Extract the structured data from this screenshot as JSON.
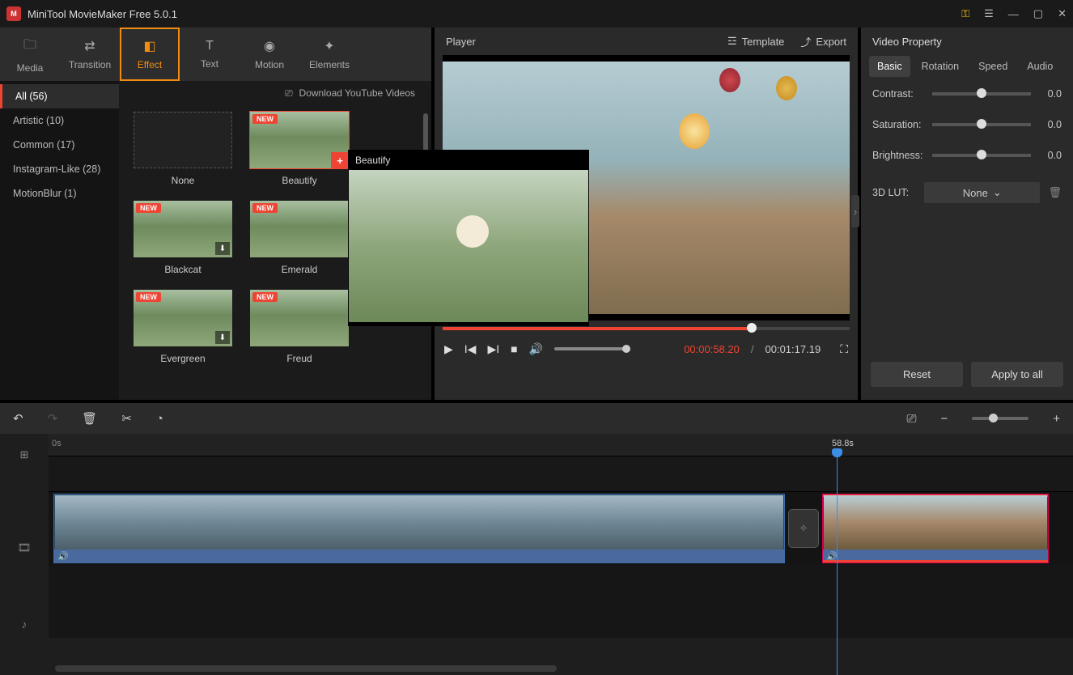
{
  "titlebar": {
    "title": "MiniTool MovieMaker Free 5.0.1"
  },
  "toolTabs": {
    "media": "Media",
    "transition": "Transition",
    "effect": "Effect",
    "text": "Text",
    "motion": "Motion",
    "elements": "Elements"
  },
  "categories": {
    "all": "All (56)",
    "artistic": "Artistic (10)",
    "common": "Common (17)",
    "instagram": "Instagram-Like (28)",
    "motionblur": "MotionBlur (1)"
  },
  "downloadLink": "Download YouTube Videos",
  "effects": {
    "none": "None",
    "beautify": "Beautify",
    "blackcat": "Blackcat",
    "emerald": "Emerald",
    "evergreen": "Evergreen",
    "freud": "Freud",
    "new_badge": "NEW"
  },
  "hoverPreview": {
    "title": "Beautify"
  },
  "player": {
    "title": "Player",
    "template": "Template",
    "export": "Export",
    "cur": "00:00:58.20",
    "sep": "/",
    "tot": "00:01:17.19"
  },
  "props": {
    "title": "Video Property",
    "tabs": {
      "basic": "Basic",
      "rotation": "Rotation",
      "speed": "Speed",
      "audio": "Audio"
    },
    "contrast_label": "Contrast:",
    "contrast_val": "0.0",
    "saturation_label": "Saturation:",
    "saturation_val": "0.0",
    "brightness_label": "Brightness:",
    "brightness_val": "0.0",
    "lut_label": "3D LUT:",
    "lut_val": "None",
    "reset": "Reset",
    "apply": "Apply to all"
  },
  "timeline": {
    "start": "0s",
    "playhead": "58.8s"
  }
}
